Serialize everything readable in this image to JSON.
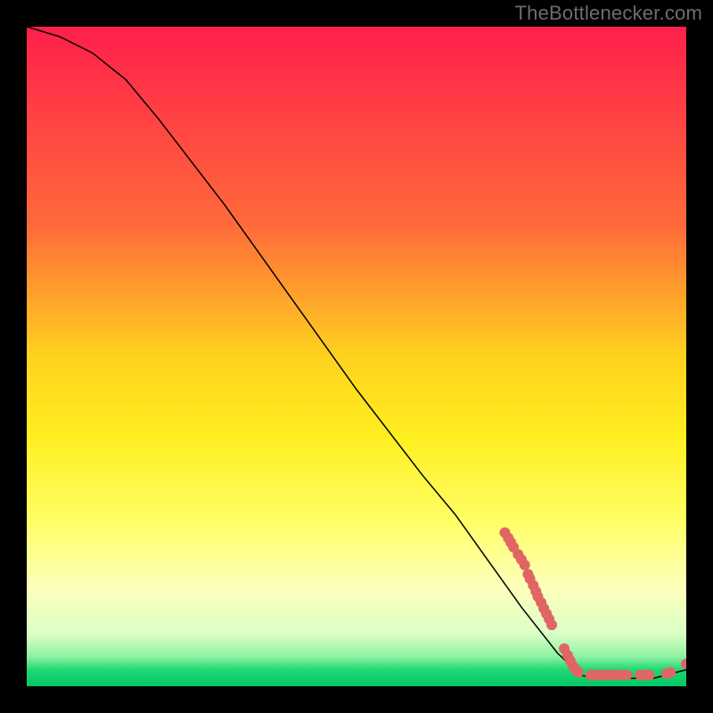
{
  "attribution": "TheBottlenecker.com",
  "chart_data": {
    "type": "line",
    "title": "",
    "xlabel": "",
    "ylabel": "",
    "xlim": [
      0,
      100
    ],
    "ylim": [
      0,
      100
    ],
    "gradient_stops": [
      {
        "t": 0.0,
        "color": "#ff1f4b"
      },
      {
        "t": 0.3,
        "color": "#ff6a3a"
      },
      {
        "t": 0.5,
        "color": "#ffd21f"
      },
      {
        "t": 0.62,
        "color": "#ffee1f"
      },
      {
        "t": 0.75,
        "color": "#ffff66"
      },
      {
        "t": 0.85,
        "color": "#fdffbb"
      },
      {
        "t": 0.92,
        "color": "#dcffc6"
      },
      {
        "t": 0.955,
        "color": "#8ef2a3"
      },
      {
        "t": 0.975,
        "color": "#1fd873"
      },
      {
        "t": 1.0,
        "color": "#00c864"
      }
    ],
    "curve": [
      {
        "x": 0,
        "y": 100
      },
      {
        "x": 5,
        "y": 98.5
      },
      {
        "x": 10,
        "y": 96.0
      },
      {
        "x": 15,
        "y": 92.0
      },
      {
        "x": 20,
        "y": 86.0
      },
      {
        "x": 30,
        "y": 73.0
      },
      {
        "x": 40,
        "y": 59.0
      },
      {
        "x": 50,
        "y": 45.0
      },
      {
        "x": 60,
        "y": 32.0
      },
      {
        "x": 65,
        "y": 26.0
      },
      {
        "x": 70,
        "y": 19.0
      },
      {
        "x": 75,
        "y": 12.0
      },
      {
        "x": 80.5,
        "y": 5.0
      },
      {
        "x": 84,
        "y": 1.7
      },
      {
        "x": 86,
        "y": 1.2
      },
      {
        "x": 95,
        "y": 1.2
      },
      {
        "x": 100,
        "y": 2.5
      }
    ],
    "markers": [
      {
        "x": 72.5,
        "y": 23.3
      },
      {
        "x": 73.0,
        "y": 22.5
      },
      {
        "x": 73.4,
        "y": 21.8
      },
      {
        "x": 73.8,
        "y": 21.1
      },
      {
        "x": 74.5,
        "y": 20.0
      },
      {
        "x": 75.0,
        "y": 19.2
      },
      {
        "x": 75.5,
        "y": 18.4
      },
      {
        "x": 76.0,
        "y": 17.0
      },
      {
        "x": 76.3,
        "y": 16.3
      },
      {
        "x": 76.8,
        "y": 15.3
      },
      {
        "x": 77.2,
        "y": 14.4
      },
      {
        "x": 77.5,
        "y": 13.6
      },
      {
        "x": 78.0,
        "y": 12.7
      },
      {
        "x": 78.4,
        "y": 11.8
      },
      {
        "x": 78.8,
        "y": 11.0
      },
      {
        "x": 79.2,
        "y": 10.2
      },
      {
        "x": 79.6,
        "y": 9.3
      },
      {
        "x": 81.5,
        "y": 5.7
      },
      {
        "x": 82.0,
        "y": 4.7
      },
      {
        "x": 82.4,
        "y": 3.9
      },
      {
        "x": 82.8,
        "y": 3.1
      },
      {
        "x": 83.2,
        "y": 2.6
      },
      {
        "x": 83.6,
        "y": 2.1
      },
      {
        "x": 85.5,
        "y": 1.7
      },
      {
        "x": 86.0,
        "y": 1.7
      },
      {
        "x": 86.6,
        "y": 1.7
      },
      {
        "x": 87.2,
        "y": 1.7
      },
      {
        "x": 87.8,
        "y": 1.7
      },
      {
        "x": 88.4,
        "y": 1.7
      },
      {
        "x": 89.0,
        "y": 1.7
      },
      {
        "x": 89.7,
        "y": 1.7
      },
      {
        "x": 90.4,
        "y": 1.7
      },
      {
        "x": 91.0,
        "y": 1.7
      },
      {
        "x": 93.0,
        "y": 1.7
      },
      {
        "x": 93.7,
        "y": 1.7
      },
      {
        "x": 94.4,
        "y": 1.7
      },
      {
        "x": 97.0,
        "y": 1.9
      },
      {
        "x": 97.6,
        "y": 2.1
      },
      {
        "x": 100.0,
        "y": 3.4
      }
    ],
    "marker_color": "#e06666",
    "marker_radius": 6,
    "line_color": "#000000",
    "line_width": 1.5
  }
}
